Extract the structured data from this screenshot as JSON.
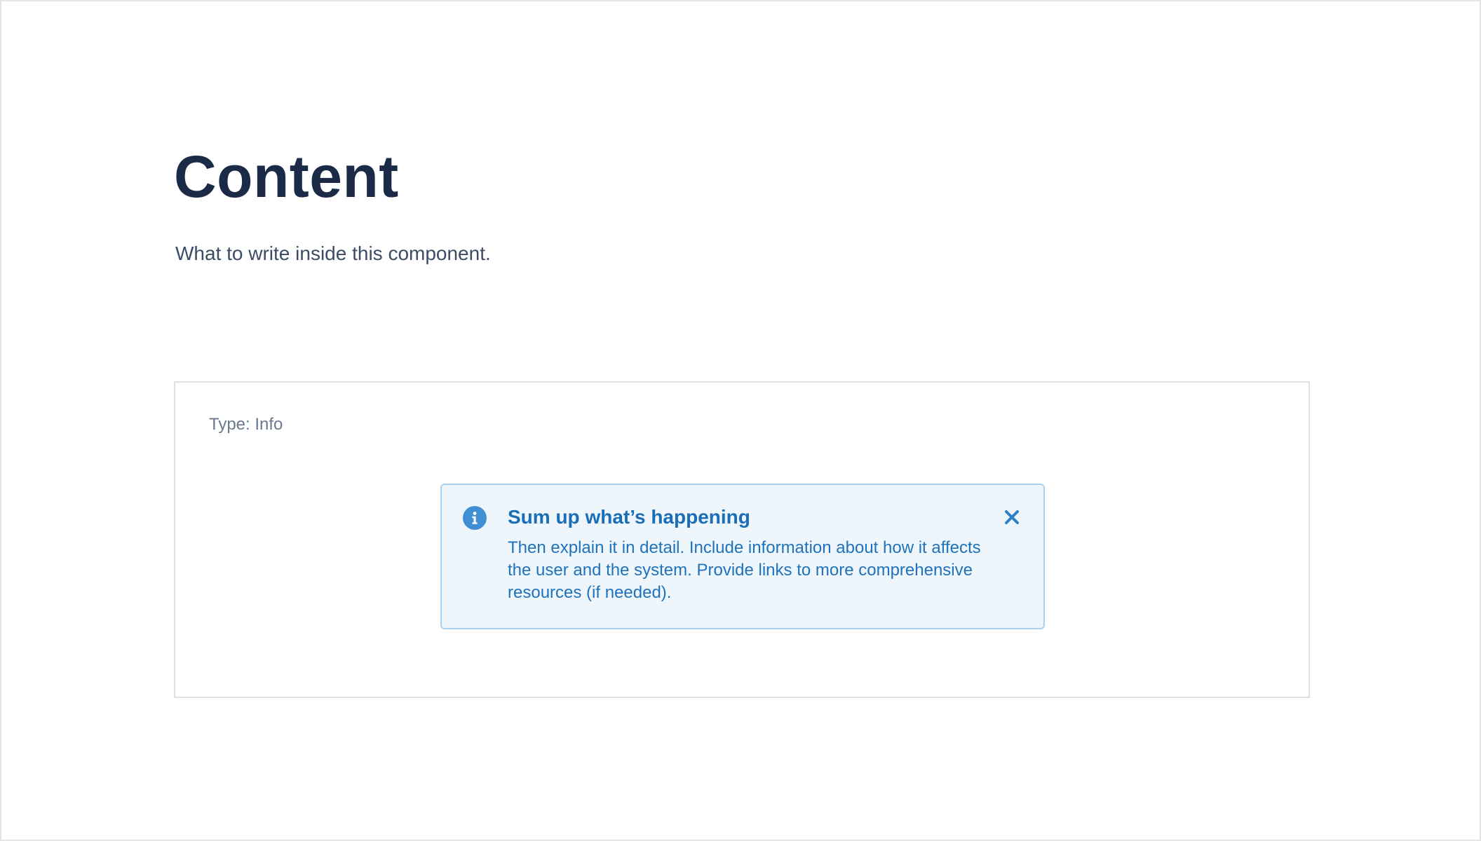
{
  "header": {
    "title": "Content",
    "subtitle": "What to write inside this component."
  },
  "example": {
    "type_label": "Type: Info",
    "alert": {
      "icon": "info-icon",
      "title": "Sum up what’s happening",
      "body": "Then explain it in detail. Include information about how it affects the user and the system. Provide links to more comprehensive resources (if needed).",
      "close_icon": "close-icon"
    }
  },
  "colors": {
    "heading": "#1b2a46",
    "subtitle": "#3d4c66",
    "alert_background": "#eef6fc",
    "alert_border": "#a9d2f2",
    "alert_text": "#1a6db7",
    "info_icon": "#3f8fd2"
  }
}
